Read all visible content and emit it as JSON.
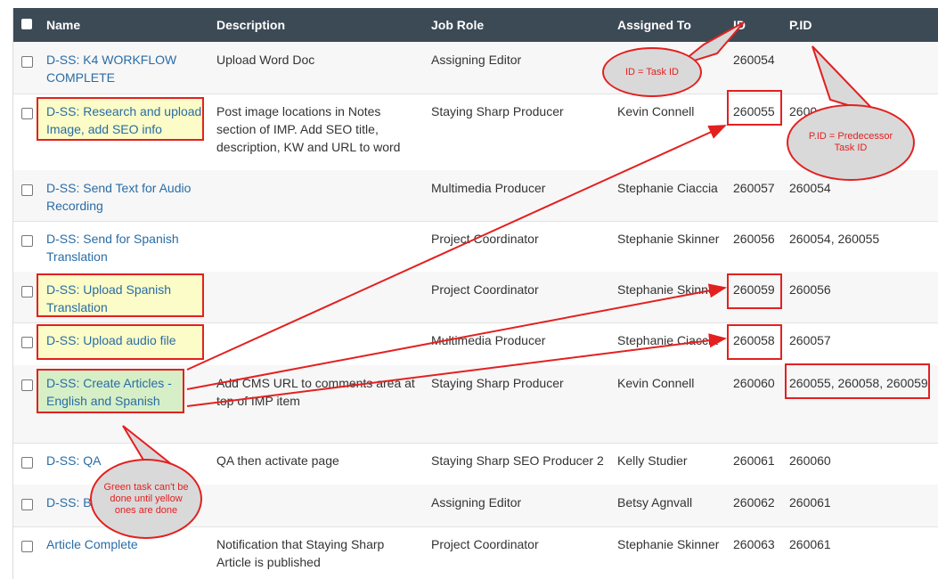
{
  "header": {
    "name": "Name",
    "description": "Description",
    "job_role": "Job Role",
    "assigned_to": "Assigned To",
    "id": "ID",
    "pid": "P.ID"
  },
  "rows": [
    {
      "name": "D-SS: K4 WORKFLOW COMPLETE",
      "description": "Upload Word Doc",
      "role": "Assigning Editor",
      "assigned": "",
      "id": "260054",
      "pid": ""
    },
    {
      "name": "D-SS: Research and upload Image, add SEO info",
      "description": "Post image locations in Notes section of IMP. Add SEO title, description, KW and URL to word",
      "role": "Staying Sharp Producer",
      "assigned": "Kevin Connell",
      "id": "260055",
      "pid": "2600"
    },
    {
      "name": "D-SS: Send Text for Audio Recording",
      "description": "",
      "role": "Multimedia Producer",
      "assigned": "Stephanie Ciaccia",
      "id": "260057",
      "pid": "260054"
    },
    {
      "name": "D-SS: Send for Spanish Translation",
      "description": "",
      "role": "Project Coordinator",
      "assigned": "Stephanie Skinner",
      "id": "260056",
      "pid": "260054, 260055"
    },
    {
      "name": "D-SS: Upload Spanish Translation",
      "description": "",
      "role": "Project Coordinator",
      "assigned": "Stephanie Skinner",
      "id": "260059",
      "pid": "260056"
    },
    {
      "name": "D-SS: Upload audio file",
      "description": "",
      "role": "Multimedia Producer",
      "assigned": "Stephanie Ciaccia",
      "id": "260058",
      "pid": "260057"
    },
    {
      "name": "D-SS: Create Articles - English and Spanish",
      "description": "Add CMS URL to comments area at top of IMP item",
      "role": "Staying Sharp Producer",
      "assigned": "Kevin Connell",
      "id": "260060",
      "pid": "260055, 260058, 260059"
    },
    {
      "name": "D-SS: QA",
      "description": "QA then activate page",
      "role": "Staying Sharp SEO Producer 2",
      "assigned": "Kelly Studier",
      "id": "260061",
      "pid": "260060"
    },
    {
      "name": "D-SS: B",
      "description": "",
      "role": "Assigning Editor",
      "assigned": "Betsy Agnvall",
      "id": "260062",
      "pid": "260061"
    },
    {
      "name": "Article Complete",
      "description": "Notification that Staying Sharp Article is published",
      "role": "Project Coordinator",
      "assigned": "Stephanie Skinner",
      "id": "260063",
      "pid": "260061"
    }
  ],
  "callouts": {
    "id_note": "ID = Task ID",
    "pid_note": "P.ID = Predecessor Task ID",
    "green_note": "Green task can't be done until yellow ones are done"
  },
  "colors": {
    "header_bg": "#3c4a56",
    "link": "#2a6ca5",
    "annotation_red": "#e32020",
    "yellow_highlight": "#fbfcc7",
    "green_highlight": "#d6efc6"
  }
}
